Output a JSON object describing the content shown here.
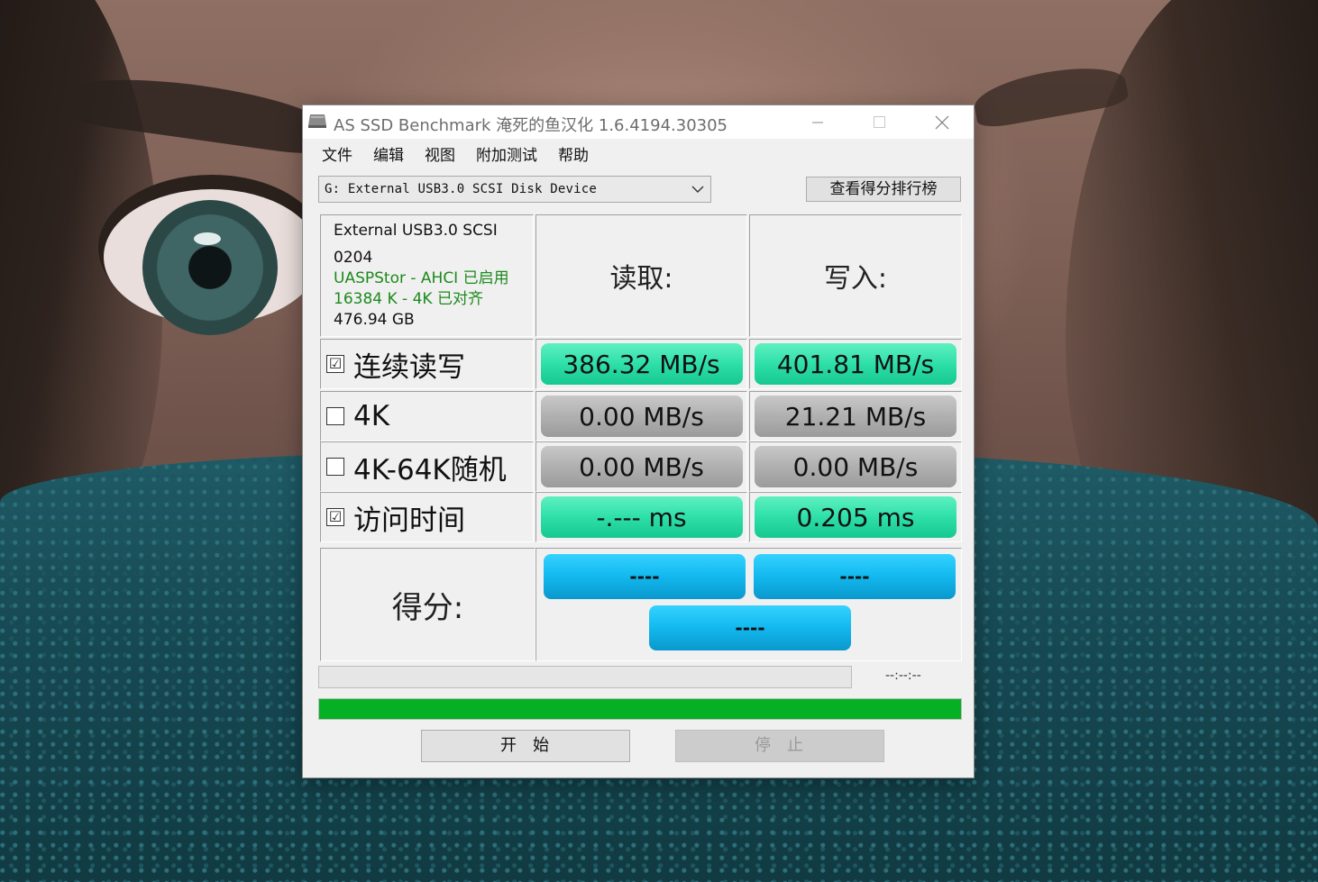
{
  "window": {
    "title": "AS SSD Benchmark 淹死的鱼汉化 1.6.4194.30305"
  },
  "menu": [
    {
      "label": "文件"
    },
    {
      "label": "编辑"
    },
    {
      "label": "视图"
    },
    {
      "label": "附加测试"
    },
    {
      "label": "帮助"
    }
  ],
  "drive": {
    "selected": "G: External USB3.0 SCSI Disk Device"
  },
  "ranking_button": "查看得分排行榜",
  "info": {
    "model": "External USB3.0 SCSI",
    "firmware": "0204",
    "driver": "UASPStor - AHCI 已启用",
    "alignment": "16384 K - 4K 已对齐",
    "capacity": "476.94 GB"
  },
  "headers": {
    "read": "读取:",
    "write": "写入:"
  },
  "rows": [
    {
      "label": "连续读写",
      "checked": true,
      "check_glyph": "☑",
      "read": "386.32 MB/s",
      "write": "401.81 MB/s",
      "read_state": "green",
      "write_state": "green"
    },
    {
      "label": "4K",
      "checked": false,
      "check_glyph": "",
      "read": "0.00 MB/s",
      "write": "21.21 MB/s",
      "read_state": "gray",
      "write_state": "gray"
    },
    {
      "label": "4K-64K随机",
      "checked": false,
      "check_glyph": "",
      "read": "0.00 MB/s",
      "write": "0.00 MB/s",
      "read_state": "gray",
      "write_state": "gray"
    },
    {
      "label": "访问时间",
      "checked": true,
      "check_glyph": "☑",
      "read": "-.--- ms",
      "write": "0.205 ms",
      "read_state": "green",
      "write_state": "green"
    }
  ],
  "score": {
    "label": "得分:",
    "read": "----",
    "write": "----",
    "total": "----"
  },
  "progress": {
    "elapsed": "--:--:--",
    "main_fraction": 1.0
  },
  "buttons": {
    "start": "开始",
    "stop": "停止"
  },
  "colors": {
    "pill_green": "#2ee0a8",
    "pill_gray": "#b0b0b0",
    "score_blue": "#12b8ef",
    "progress_green": "#06b025",
    "info_green": "#1c8a1c"
  }
}
